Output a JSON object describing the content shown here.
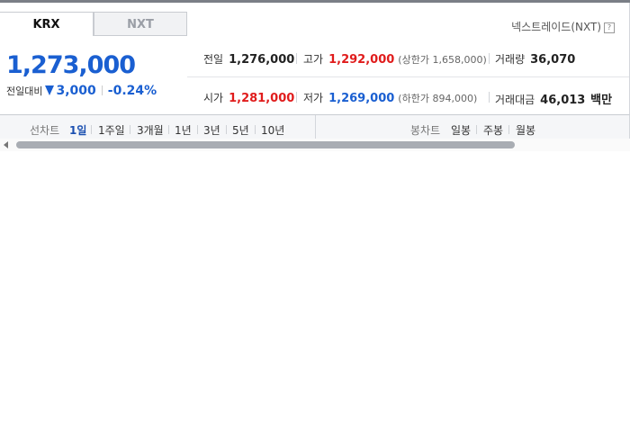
{
  "tabs": [
    {
      "label": "KRX",
      "active": true
    },
    {
      "label": "NXT",
      "active": false
    }
  ],
  "nxt_link": {
    "label": "넥스트레이드(NXT)",
    "help_icon": "?"
  },
  "quote": {
    "price": "1,273,000",
    "change_label": "전일대비",
    "direction": "down",
    "change_amount": "3,000",
    "change_pct": "-0.24%"
  },
  "stats": {
    "prev_close": {
      "label": "전일",
      "value": "1,276,000"
    },
    "high": {
      "label": "고가",
      "value": "1,292,000"
    },
    "upper_limit": {
      "label": "상한가",
      "value": "1,658,000"
    },
    "volume": {
      "label": "거래량",
      "value": "36,070"
    },
    "open": {
      "label": "시가",
      "value": "1,281,000"
    },
    "low": {
      "label": "저가",
      "value": "1,269,000"
    },
    "lower_limit": {
      "label": "하한가",
      "value": "894,000"
    },
    "turnover": {
      "label": "거래대금",
      "value": "46,013",
      "unit": "백만"
    }
  },
  "chart_controls": {
    "line_chart_label": "선차트",
    "line_periods": [
      "1일",
      "1주일",
      "3개월",
      "1년",
      "3년",
      "5년",
      "10년"
    ],
    "line_active_index": 0,
    "candle_chart_label": "봉차트",
    "candle_periods": [
      "일봉",
      "주봉",
      "월봉"
    ]
  },
  "colors": {
    "up": "#e01c1c",
    "down": "#1a5fd1",
    "active_tab": "#1a4fb0"
  }
}
